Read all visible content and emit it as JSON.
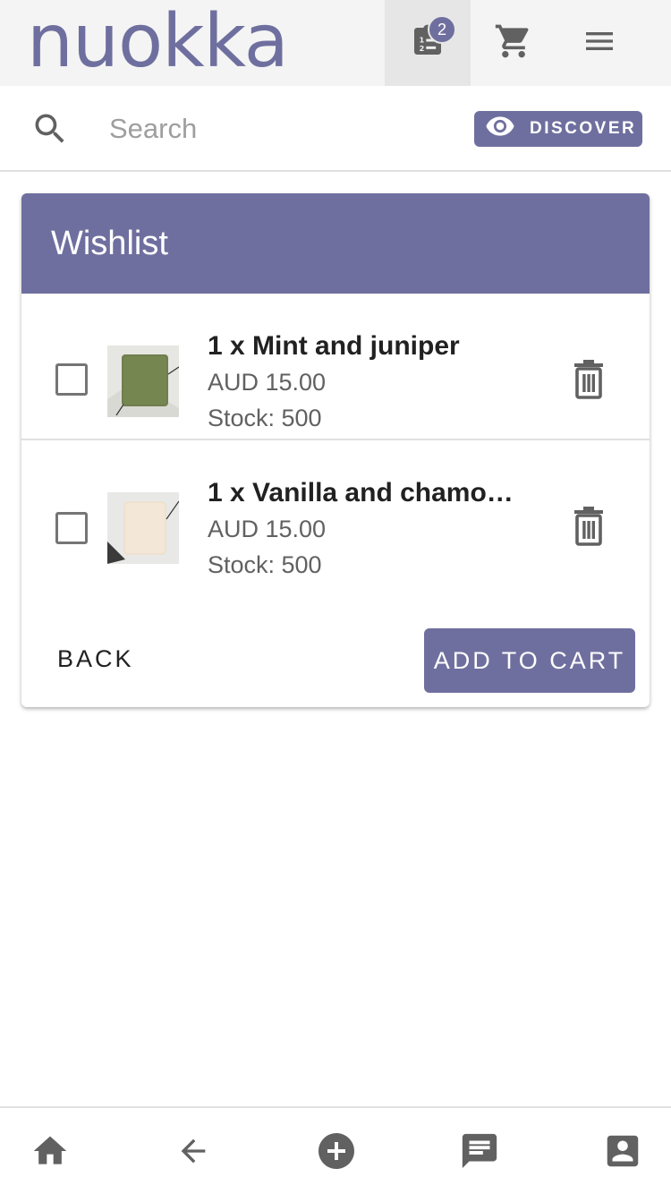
{
  "colors": {
    "accent": "#6f6f9f",
    "icon_gray": "#616161"
  },
  "header": {
    "logo_text": "nuokka",
    "notes_badge_count": "2",
    "icons": [
      "notes-list-icon",
      "cart-icon",
      "menu-icon"
    ]
  },
  "search": {
    "placeholder": "Search",
    "value": "",
    "discover_label": "DISCOVER",
    "discover_icon": "eye-icon"
  },
  "wishlist": {
    "title": "Wishlist",
    "items": [
      {
        "title": "1 x Mint and juniper",
        "price": "AUD 15.00",
        "stock": "Stock: 500",
        "checked": false,
        "thumb_color": "#6f7f4c"
      },
      {
        "title": "1 x Vanilla and chamo…",
        "price": "AUD 15.00",
        "stock": "Stock: 500",
        "checked": false,
        "thumb_color": "#eee1cf"
      }
    ],
    "back_label": "BACK",
    "add_to_cart_label": "ADD TO CART"
  },
  "bottom_nav": {
    "items": [
      "home-icon",
      "back-arrow-icon",
      "add-circle-icon",
      "chat-icon",
      "account-icon"
    ]
  }
}
